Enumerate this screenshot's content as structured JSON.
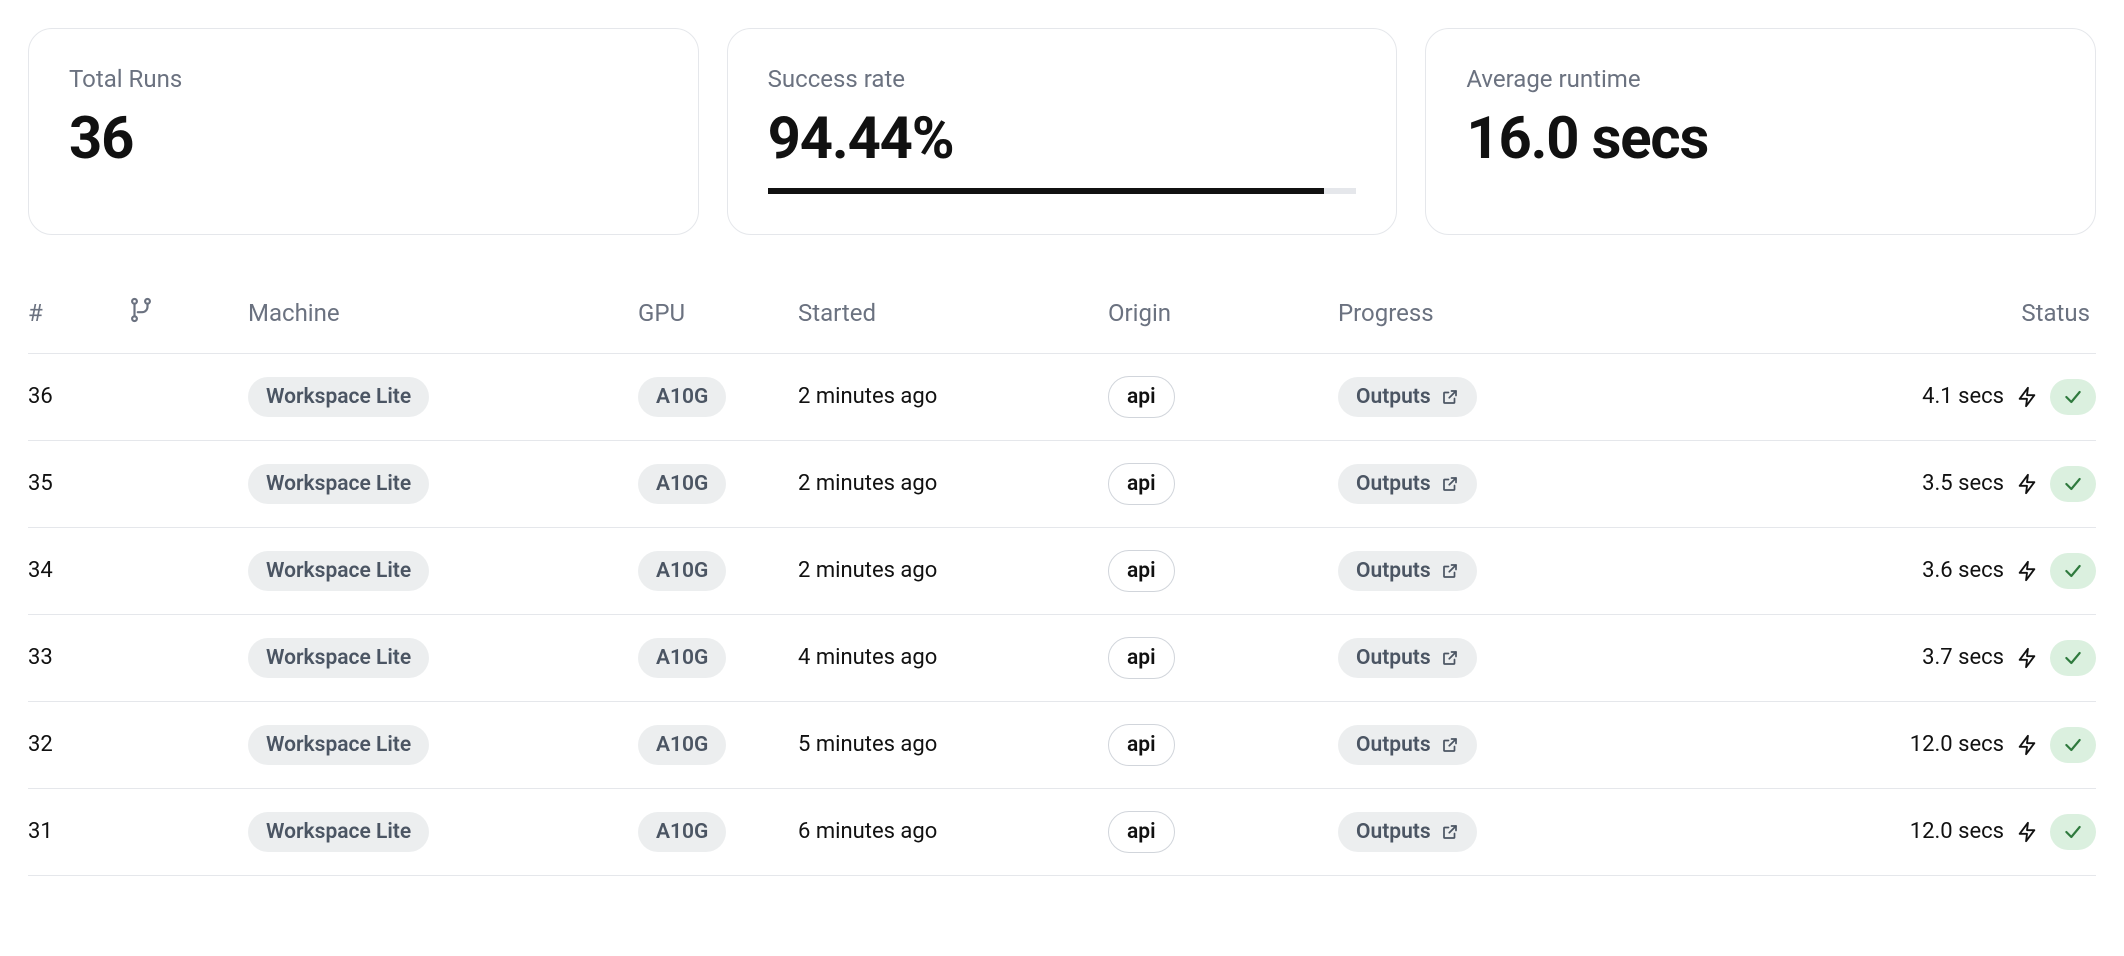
{
  "stats": {
    "total_runs": {
      "label": "Total Runs",
      "value": "36"
    },
    "success_rate": {
      "label": "Success rate",
      "value": "94.44%",
      "progress_pct": 94.44
    },
    "avg_runtime": {
      "label": "Average runtime",
      "value": "16.0 secs"
    }
  },
  "table": {
    "headers": {
      "number": "#",
      "branch": "",
      "machine": "Machine",
      "gpu": "GPU",
      "started": "Started",
      "origin": "Origin",
      "progress": "Progress",
      "status": "Status"
    },
    "outputs_label": "Outputs",
    "rows": [
      {
        "id": "36",
        "machine": "Workspace Lite",
        "gpu": "A10G",
        "started": "2 minutes ago",
        "origin": "api",
        "duration": "4.1 secs"
      },
      {
        "id": "35",
        "machine": "Workspace Lite",
        "gpu": "A10G",
        "started": "2 minutes ago",
        "origin": "api",
        "duration": "3.5 secs"
      },
      {
        "id": "34",
        "machine": "Workspace Lite",
        "gpu": "A10G",
        "started": "2 minutes ago",
        "origin": "api",
        "duration": "3.6 secs"
      },
      {
        "id": "33",
        "machine": "Workspace Lite",
        "gpu": "A10G",
        "started": "4 minutes ago",
        "origin": "api",
        "duration": "3.7 secs"
      },
      {
        "id": "32",
        "machine": "Workspace Lite",
        "gpu": "A10G",
        "started": "5 minutes ago",
        "origin": "api",
        "duration": "12.0 secs"
      },
      {
        "id": "31",
        "machine": "Workspace Lite",
        "gpu": "A10G",
        "started": "6 minutes ago",
        "origin": "api",
        "duration": "12.0 secs"
      }
    ]
  }
}
